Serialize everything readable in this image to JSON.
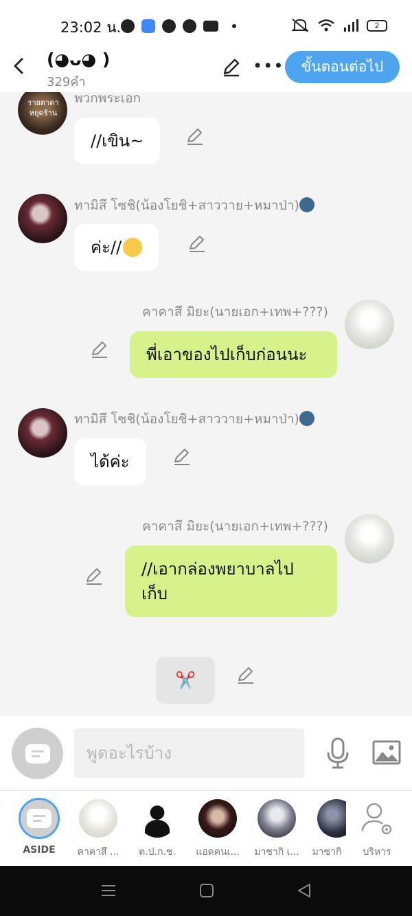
{
  "status": {
    "time": "23:02 น.",
    "battery": "2"
  },
  "header": {
    "title": "(◕ᴗ◕ )",
    "word_count": "329คำ",
    "next_label": "ขั้นตอนต่อไป"
  },
  "messages": [
    {
      "name": "พวกพระเอก",
      "text": "//เขิน~",
      "avatar_text": "รายตาดา\nหยุดร้าน"
    },
    {
      "name": "ทามิสึ โซชิ(น้องโยชิ+สาววาย+หมาป่า)",
      "text": "ค่ะ//"
    },
    {
      "name": "คาคาสึ มิยะ(นายเอก+เทพ+???)",
      "text": "พี่เอาของไปเก็บก่อนนะ"
    },
    {
      "name": "ทามิสึ โซชิ(น้องโยชิ+สาววาย+หมาป่า)",
      "text": "ได้ค่ะ"
    },
    {
      "name": "คาคาสึ มิยะ(นายเอก+เทพ+???)",
      "text": "//เอากล่องพยาบาลไปเก็บ"
    }
  ],
  "scissors_glyph": "✂️",
  "input": {
    "placeholder": "พูดอะไรบ้าง"
  },
  "characters": [
    {
      "label": "ASIDE"
    },
    {
      "label": "คาคาสึ ..."
    },
    {
      "label": "ต.ป.ก.ช."
    },
    {
      "label": "แอดคนเ..."
    },
    {
      "label": "มาซากิ เ..."
    },
    {
      "label": "มาซากิ"
    },
    {
      "label": "บริหาร"
    }
  ]
}
